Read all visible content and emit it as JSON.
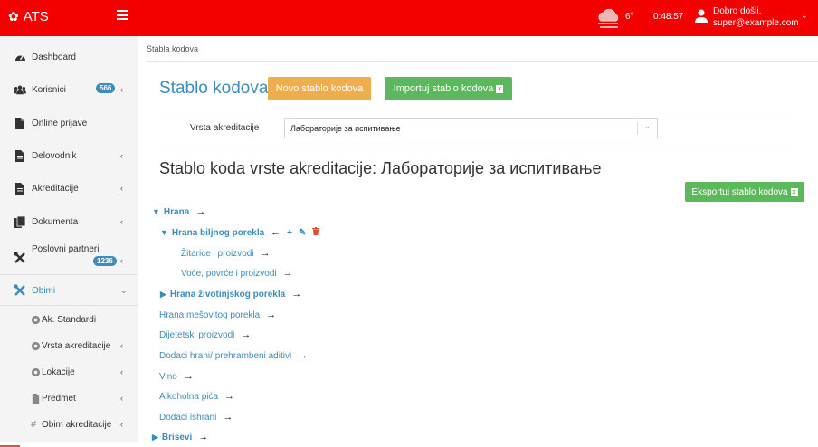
{
  "topbar": {
    "brand": "ATS",
    "temperature": "6°",
    "clock": "0:48:57",
    "greeting": "Dobro došli,",
    "email": "super@example.com",
    "accent": "#f30000"
  },
  "sidebar": {
    "items": [
      {
        "label": "Dashboard",
        "icon": "dashboard-icon"
      },
      {
        "label": "Korisnici",
        "icon": "users-icon",
        "badge": "566"
      },
      {
        "label": "Online prijave",
        "icon": "file-icon"
      },
      {
        "label": "Delovodnik",
        "icon": "file-text-icon"
      },
      {
        "label": "Akreditacije",
        "icon": "file-text-icon"
      },
      {
        "label": "Dokumenta",
        "icon": "files-icon"
      },
      {
        "label": "Poslovni partneri",
        "icon": "tools-icon",
        "badge": "1236"
      },
      {
        "label": "Obimi",
        "icon": "tools-icon"
      }
    ],
    "sub_items": [
      {
        "label": "Ak. Standardi",
        "icon": "cog-icon"
      },
      {
        "label": "Vrsta akreditacije",
        "icon": "cog-icon"
      },
      {
        "label": "Lokacije",
        "icon": "cog-icon"
      },
      {
        "label": "Predmet",
        "icon": "file-icon"
      },
      {
        "label": "Obim akreditacije",
        "icon": "hash-icon"
      }
    ]
  },
  "breadcrumb": "Stabla kodova",
  "page_title": "Stablo kodova",
  "buttons": {
    "new": "Novo stablo kodova",
    "import": "Importuj stablo kodova",
    "export": "Eksportuj stablo kodova"
  },
  "filter": {
    "label": "Vrsta akreditacije",
    "selected": "Лабораторије за испитивање"
  },
  "subtitle": "Stablo koda vrste akreditacije: Лабораторије за испитивање",
  "tree": [
    {
      "label": "Hrana",
      "expanded": true,
      "bold": true
    },
    {
      "label": "Hrana biljnog porekla",
      "expanded": true,
      "bold": true
    },
    {
      "label": "Žitarice i proizvodi"
    },
    {
      "label": "Voće, povrće i proizvodi"
    },
    {
      "label": "Hrana životinjskog porekla",
      "expanded": false,
      "bold": true
    },
    {
      "label": "Hrana mešovitog porekla"
    },
    {
      "label": "Dijetetski proizvodi"
    },
    {
      "label": "Dodaci hrani/ prehrambeni aditivi"
    },
    {
      "label": "Vino"
    },
    {
      "label": "Alkoholna pića"
    },
    {
      "label": "Dodaci ishrani"
    },
    {
      "label": "Brisevi",
      "expanded": false,
      "bold": true
    }
  ],
  "colors": {
    "primary": "#3c8dbc",
    "warning": "#f0ad4e",
    "success": "#5cb85c",
    "danger": "#dd4b39"
  }
}
